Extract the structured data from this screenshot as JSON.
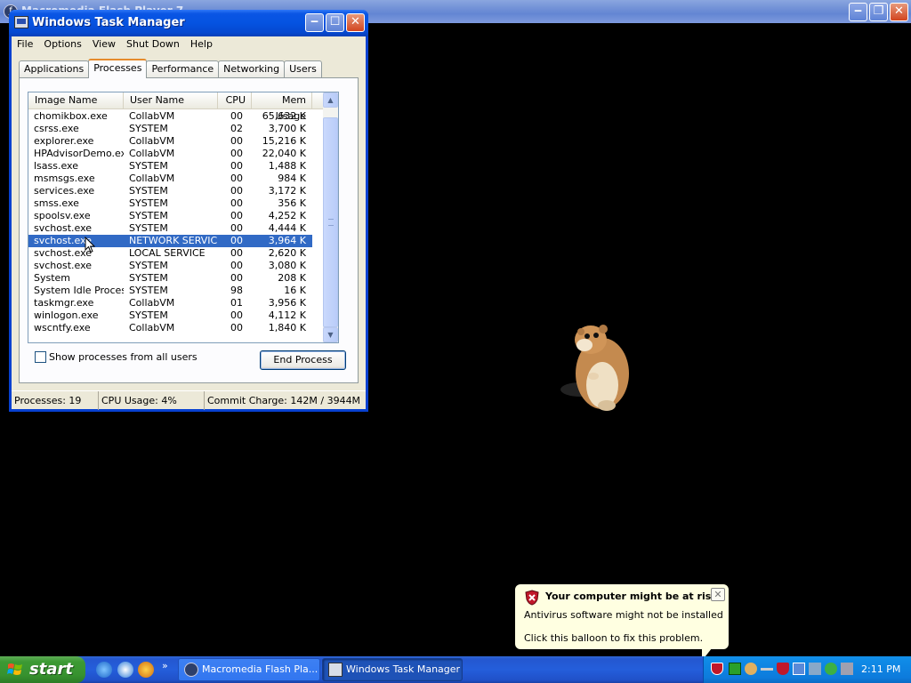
{
  "background_window": {
    "title": "Macromedia Flash Player 7"
  },
  "task_manager": {
    "title": "Windows Task Manager",
    "menu": [
      "File",
      "Options",
      "View",
      "Shut Down",
      "Help"
    ],
    "tabs": [
      "Applications",
      "Processes",
      "Performance",
      "Networking",
      "Users"
    ],
    "active_tab": "Processes",
    "columns": [
      "Image Name",
      "User Name",
      "CPU",
      "Mem Usage"
    ],
    "processes": [
      {
        "name": "chomikbox.exe",
        "user": "CollabVM",
        "cpu": "00",
        "mem": "65,632 K"
      },
      {
        "name": "csrss.exe",
        "user": "SYSTEM",
        "cpu": "02",
        "mem": "3,700 K"
      },
      {
        "name": "explorer.exe",
        "user": "CollabVM",
        "cpu": "00",
        "mem": "15,216 K"
      },
      {
        "name": "HPAdvisorDemo.exe",
        "user": "CollabVM",
        "cpu": "00",
        "mem": "22,040 K"
      },
      {
        "name": "lsass.exe",
        "user": "SYSTEM",
        "cpu": "00",
        "mem": "1,488 K"
      },
      {
        "name": "msmsgs.exe",
        "user": "CollabVM",
        "cpu": "00",
        "mem": "984 K"
      },
      {
        "name": "services.exe",
        "user": "SYSTEM",
        "cpu": "00",
        "mem": "3,172 K"
      },
      {
        "name": "smss.exe",
        "user": "SYSTEM",
        "cpu": "00",
        "mem": "356 K"
      },
      {
        "name": "spoolsv.exe",
        "user": "SYSTEM",
        "cpu": "00",
        "mem": "4,252 K"
      },
      {
        "name": "svchost.exe",
        "user": "SYSTEM",
        "cpu": "00",
        "mem": "4,444 K"
      },
      {
        "name": "svchost.exe",
        "user": "NETWORK SERVICE",
        "cpu": "00",
        "mem": "3,964 K",
        "selected": true
      },
      {
        "name": "svchost.exe",
        "user": "LOCAL SERVICE",
        "cpu": "00",
        "mem": "2,620 K"
      },
      {
        "name": "svchost.exe",
        "user": "SYSTEM",
        "cpu": "00",
        "mem": "3,080 K"
      },
      {
        "name": "System",
        "user": "SYSTEM",
        "cpu": "00",
        "mem": "208 K"
      },
      {
        "name": "System Idle Process",
        "user": "SYSTEM",
        "cpu": "98",
        "mem": "16 K"
      },
      {
        "name": "taskmgr.exe",
        "user": "CollabVM",
        "cpu": "01",
        "mem": "3,956 K"
      },
      {
        "name": "winlogon.exe",
        "user": "SYSTEM",
        "cpu": "00",
        "mem": "4,112 K"
      },
      {
        "name": "wscntfy.exe",
        "user": "CollabVM",
        "cpu": "00",
        "mem": "1,840 K"
      }
    ],
    "show_all_label": "Show processes from all users",
    "show_all_checked": false,
    "end_process_label": "End Process",
    "status": {
      "processes": "Processes: 19",
      "cpu": "CPU Usage: 4%",
      "commit": "Commit Charge: 142M / 3944M"
    }
  },
  "balloon": {
    "title": "Your computer might be at risk",
    "line1": "Antivirus software might not be installed",
    "line2": "Click this balloon to fix this problem.",
    "close_glyph": "✕"
  },
  "taskbar": {
    "start_label": "start",
    "chevron": "»",
    "buttons": [
      {
        "label": "Macromedia Flash Pla...",
        "active": false
      },
      {
        "label": "Windows Task Manager",
        "active": true
      }
    ],
    "clock": "2:11 PM"
  },
  "colors": {
    "selection": "#316ac5",
    "xp_blue": "#0553e1",
    "start_green": "#3c9a34",
    "balloon_bg": "#ffffe1"
  }
}
